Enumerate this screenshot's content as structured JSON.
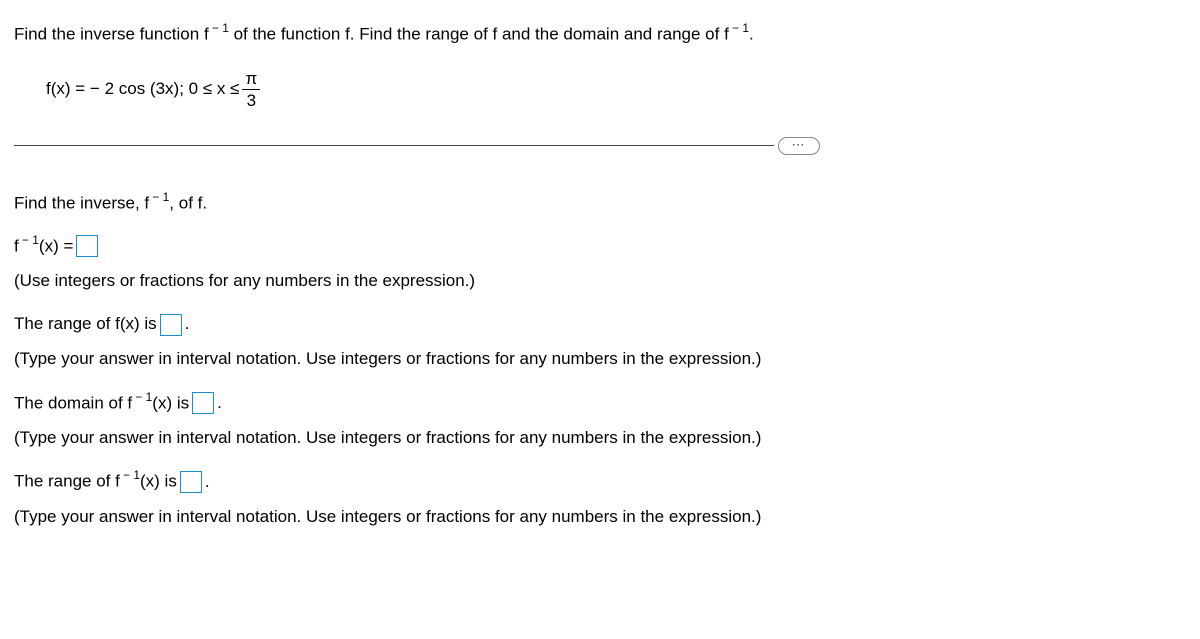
{
  "intro": {
    "part1": "Find the inverse function f",
    "sup1": " − 1",
    "part2": " of the function f. Find the range of f and the domain and range of f",
    "sup2": " − 1",
    "part3": "."
  },
  "function_def": {
    "lhs": "f(x) = − 2 cos (3x); 0 ≤ x ≤ ",
    "frac_num": "π",
    "frac_den": "3"
  },
  "prompt": {
    "p1": "Find the inverse, f",
    "sup": " − 1",
    "p2": ", of f."
  },
  "q1": {
    "lhs1": "f",
    "sup": " − 1",
    "lhs2": "(x) = ",
    "hint": "(Use integers or fractions for any numbers in the expression.)"
  },
  "q2": {
    "text1": "The range of f(x) is ",
    "text2": ".",
    "hint": "(Type your answer in interval notation. Use integers or fractions for any numbers in the expression.)"
  },
  "q3": {
    "t1": "The domain of f",
    "sup": " − 1",
    "t2": "(x) is ",
    "t3": ".",
    "hint": "(Type your answer in interval notation. Use integers or fractions for any numbers in the expression.)"
  },
  "q4": {
    "t1": "The range of f",
    "sup": " − 1",
    "t2": "(x) is ",
    "t3": ".",
    "hint": "(Type your answer in interval notation. Use integers or fractions for any numbers in the expression.)"
  },
  "more_label": "⋯"
}
